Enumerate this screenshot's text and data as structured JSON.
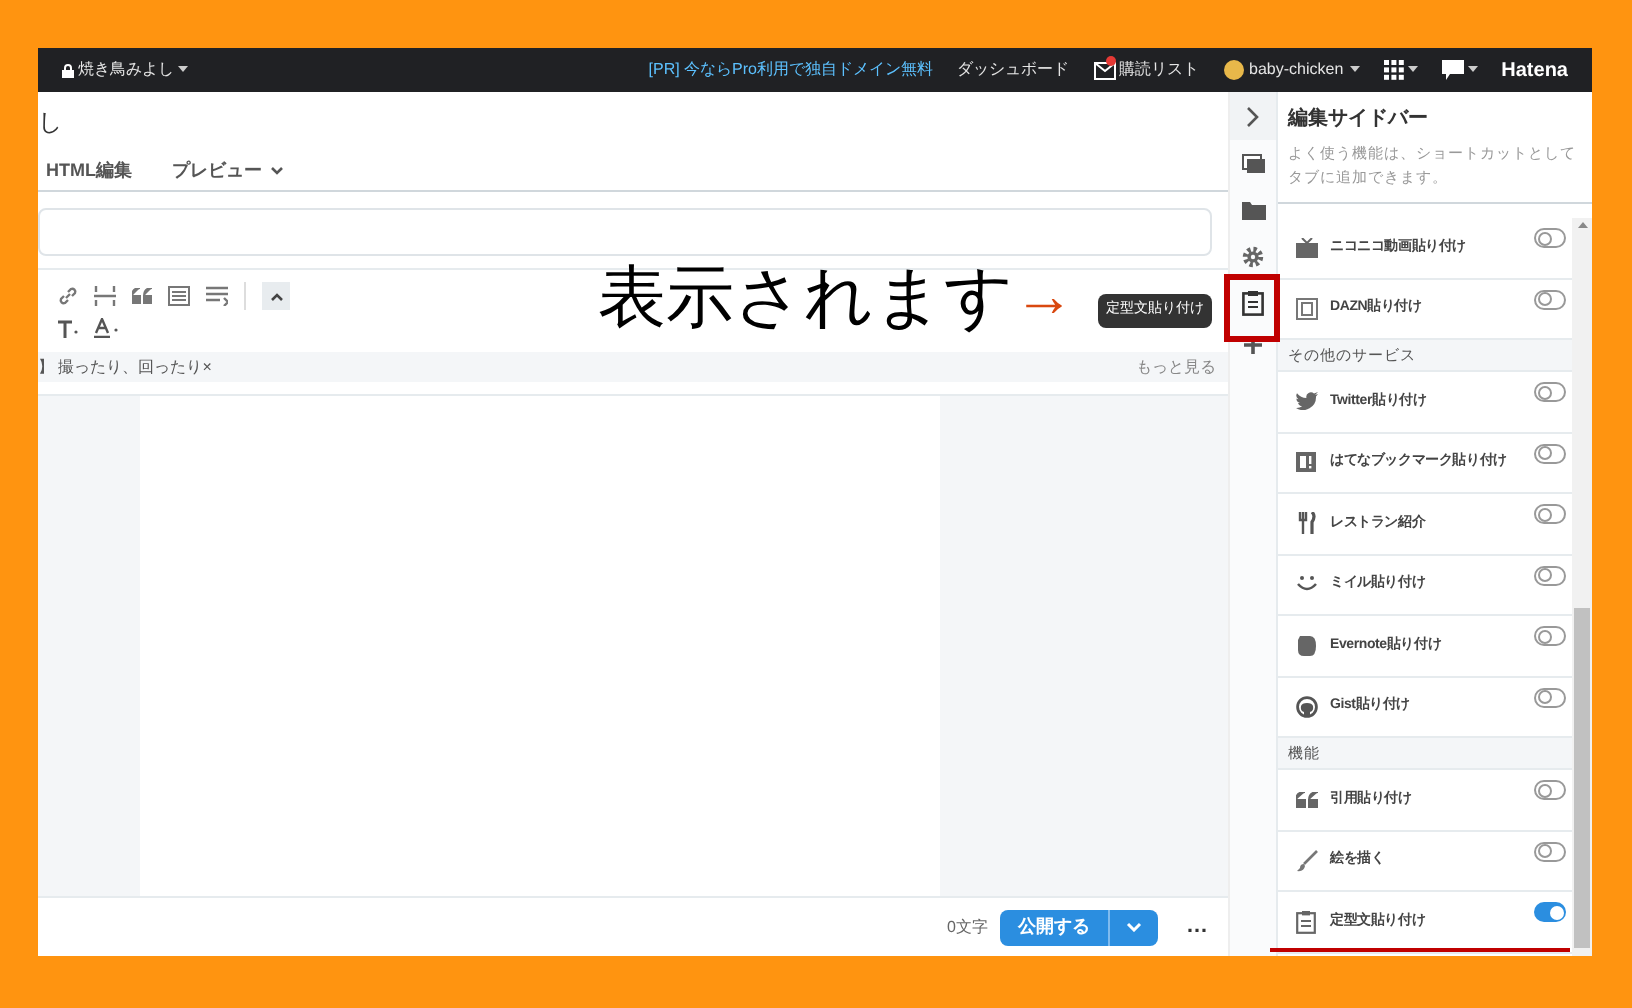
{
  "top_bar": {
    "blog_name": "焼き鳥みよし",
    "promo": "[PR] 今ならPro利用で独自ドメイン無料",
    "dashboard": "ダッシュボード",
    "reading_list": "購読リスト",
    "reading_list_unread": true,
    "user": "baby-chicken",
    "brand": "Hatena"
  },
  "editor": {
    "title": "し",
    "tabs": [
      {
        "label": "HTML編集",
        "selected": false
      },
      {
        "label": "プレビュー",
        "selected": false
      }
    ],
    "tags": "】 撮ったり、回ったり×",
    "more": "もっと見る",
    "char_count": "0文字",
    "publish": "公開する",
    "more_menu": "…"
  },
  "annotation": {
    "text": "表示されます",
    "arrow": "→",
    "tooltip": "定型文貼り付け"
  },
  "sidebar": {
    "title": "編集サイドバー",
    "description": "よく使う機能は、ショートカットとしてタブに追加できます。",
    "items": [
      {
        "kind": "item",
        "label": "ニコニコ動画貼り付け",
        "on": false
      },
      {
        "kind": "item",
        "label": "DAZN貼り付け",
        "on": false
      },
      {
        "kind": "section",
        "label": "その他のサービス"
      },
      {
        "kind": "item",
        "label": "Twitter貼り付け",
        "on": false
      },
      {
        "kind": "item",
        "label": "はてなブックマーク貼り付け",
        "on": false
      },
      {
        "kind": "item",
        "label": "レストラン紹介",
        "on": false
      },
      {
        "kind": "item",
        "label": "ミイル貼り付け",
        "on": false
      },
      {
        "kind": "item",
        "label": "Evernote貼り付け",
        "on": false
      },
      {
        "kind": "item",
        "label": "Gist貼り付け",
        "on": false
      },
      {
        "kind": "section",
        "label": "機能"
      },
      {
        "kind": "item",
        "label": "引用貼り付け",
        "on": false
      },
      {
        "kind": "item",
        "label": "絵を描く",
        "on": false
      },
      {
        "kind": "item",
        "label": "定型文貼り付け",
        "on": true
      }
    ]
  }
}
